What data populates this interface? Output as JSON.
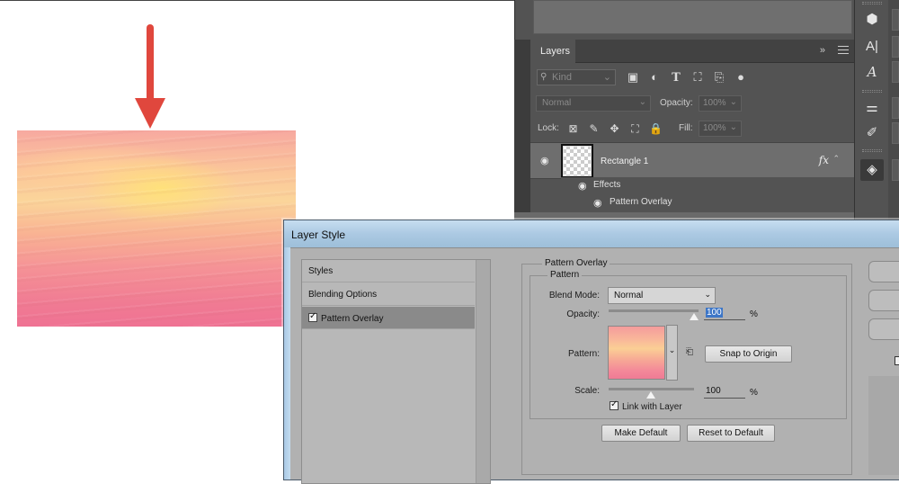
{
  "layers_panel": {
    "tab_label": "Layers",
    "collapse_glyph": "»",
    "kind_placeholder": "Kind",
    "filter_icons": [
      "image-filter-icon",
      "adjustment-filter-icon",
      "type-filter-icon",
      "shape-filter-icon",
      "smart-object-filter-icon",
      "filter-toggle-icon"
    ],
    "type_filter_glyph": "T",
    "blend_mode": "Normal",
    "opacity_label": "Opacity:",
    "opacity_value": "100%",
    "lock_label": "Lock:",
    "fill_label": "Fill:",
    "fill_value": "100%",
    "layer": {
      "name": "Rectangle 1",
      "fx_label": "fx",
      "effects_label": "Effects",
      "effect_name": "Pattern Overlay"
    }
  },
  "tool_strip": {
    "tools": [
      "3d-icon",
      "character-icon",
      "glyphs-icon",
      "properties-icon",
      "brush-settings-icon",
      "layers-icon"
    ],
    "character_glyph": "A|",
    "glyphs_glyph": "A"
  },
  "dialog": {
    "title": "Layer Style",
    "styles_list": [
      {
        "label": "Styles",
        "checkbox": false,
        "selected": false
      },
      {
        "label": "Blending Options",
        "checkbox": false,
        "selected": false
      },
      {
        "label": "Pattern Overlay",
        "checkbox": true,
        "checked": true,
        "selected": true
      }
    ],
    "section_title": "Pattern Overlay",
    "subsection_title": "Pattern",
    "blend_mode_label": "Blend Mode:",
    "blend_mode_value": "Normal",
    "opacity_label": "Opacity:",
    "opacity_value": "100",
    "opacity_unit": "%",
    "pattern_label": "Pattern:",
    "snap_button": "Snap to Origin",
    "scale_label": "Scale:",
    "scale_value": "100",
    "scale_unit": "%",
    "link_label": "Link with Layer",
    "link_checked": true,
    "make_default_button": "Make Default",
    "reset_default_button": "Reset to Default"
  },
  "colors": {
    "arrow": "#e0473d",
    "ps_panel": "#535353",
    "dialog_bg": "#b1b1b1",
    "selection": "#3d76c7"
  }
}
